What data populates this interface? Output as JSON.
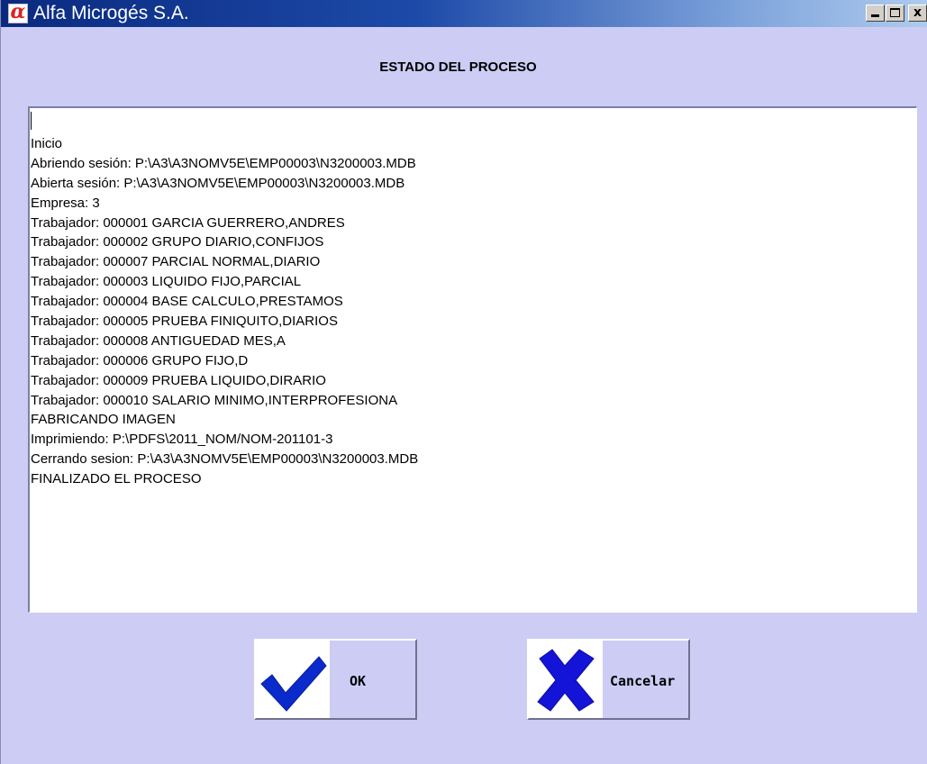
{
  "window": {
    "title": "Alfa Microgés S.A.",
    "app_icon_glyph": "α",
    "controls": {
      "minimize_icon": "minimize-icon",
      "maximize_icon": "maximize-icon",
      "close_label": "x"
    }
  },
  "subtitle": "ESTADO DEL PROCESO",
  "log": {
    "lines": [
      "Inicio",
      "Abriendo sesión: P:\\A3\\A3NOMV5E\\EMP00003\\N3200003.MDB",
      "Abierta sesión: P:\\A3\\A3NOMV5E\\EMP00003\\N3200003.MDB",
      "Empresa: 3",
      "Trabajador: 000001 GARCIA GUERRERO,ANDRES",
      "Trabajador: 000002 GRUPO DIARIO,CONFIJOS",
      "Trabajador: 000007 PARCIAL NORMAL,DIARIO",
      "Trabajador: 000003 LIQUIDO FIJO,PARCIAL",
      "Trabajador: 000004 BASE CALCULO,PRESTAMOS",
      "Trabajador: 000005 PRUEBA FINIQUITO,DIARIOS",
      "Trabajador: 000008 ANTIGUEDAD MES,A",
      "Trabajador: 000006 GRUPO FIJO,D",
      "Trabajador: 000009 PRUEBA LIQUIDO,DIRARIO",
      "Trabajador: 000010 SALARIO MINIMO,INTERPROFESIONA",
      "FABRICANDO IMAGEN",
      "Imprimiendo: P:\\PDFS\\2011_NOM/NOM-201101-3",
      "Cerrando sesion: P:\\A3\\A3NOMV5E\\EMP00003\\N3200003.MDB",
      "FINALIZADO EL PROCESO"
    ]
  },
  "buttons": {
    "ok": {
      "label": "OK",
      "icon": "checkmark-icon",
      "icon_color": "#0a2acc"
    },
    "cancel": {
      "label": "Cancelar",
      "icon": "x-mark-icon",
      "icon_color": "#1414d8"
    }
  },
  "colors": {
    "background": "#ccccf4",
    "titlebar_start": "#0a2a80",
    "titlebar_end": "#aecbee"
  }
}
